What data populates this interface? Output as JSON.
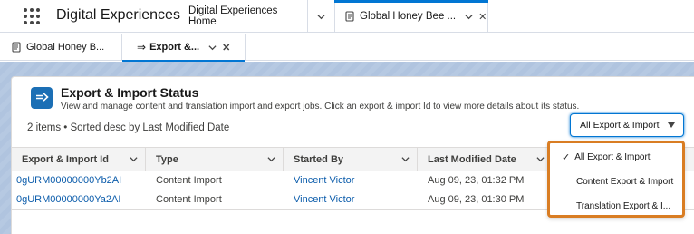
{
  "app": {
    "name": "Digital Experiences",
    "tabs": [
      {
        "label": "Digital Experiences Home"
      },
      {
        "label": "Global Honey Bee ..."
      }
    ]
  },
  "subtabs": [
    {
      "label": "Global Honey B..."
    },
    {
      "label": "Export &..."
    }
  ],
  "page": {
    "title": "Export & Import Status",
    "description": "View and manage content and translation import and export jobs. Click an export & import Id to view more details about its status.",
    "item_count": "2 items • Sorted desc by Last Modified Date",
    "filter_value": "All Export & Import"
  },
  "table": {
    "columns": [
      "Export & Import Id",
      "Type",
      "Started By",
      "Last Modified Date"
    ],
    "rows": [
      {
        "id": "0gURM00000000Yb2AI",
        "type": "Content Import",
        "started_by": "Vincent Victor",
        "modified": "Aug 09, 23, 01:32 PM"
      },
      {
        "id": "0gURM00000000Ya2AI",
        "type": "Content Import",
        "started_by": "Vincent Victor",
        "modified": "Aug 09, 23, 01:30 PM"
      }
    ]
  },
  "dropdown": {
    "options": [
      "All Export & Import",
      "Content Export & Import",
      "Translation Export & I..."
    ],
    "selected": "All Export & Import"
  },
  "colors": {
    "brand": "#0176d3",
    "link": "#0b5cab",
    "highlight_border": "#d97d23",
    "background": "#b0c4df"
  }
}
